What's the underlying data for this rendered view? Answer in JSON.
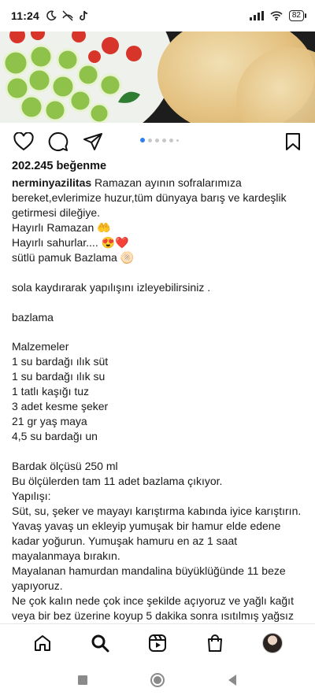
{
  "status_bar": {
    "time": "11:24",
    "icons_left": [
      "moon-icon",
      "no-wifi-call-icon",
      "tiktok-icon"
    ],
    "icons_right": [
      "signal-icon",
      "wifi-icon",
      "battery-icon"
    ],
    "battery": "82"
  },
  "post": {
    "carousel": {
      "count": 6,
      "active": 0
    },
    "likes": "202.245 beğenme",
    "username": "nerminyazilitas",
    "caption_first": "Ramazan ayının sofralarımıza",
    "caption_lines": [
      "bereket,evlerimize huzur,tüm dünyaya barış ve kardeşlik",
      "getirmesi dileğiye.",
      "Hayırlı Ramazan 🤲",
      "Hayırlı sahurlar.... 😍❤️",
      "sütlü pamuk Bazlama 🫓",
      "",
      "sola kaydırarak yapılışını izleyebilirsiniz .",
      "",
      "bazlama",
      "",
      "Malzemeler",
      "1 su bardağı ılık süt",
      "1 su bardağı ılık su",
      "1 tatlı kaşığı tuz",
      "3 adet kesme şeker",
      "21 gr yaş maya",
      "4,5 su bardağı un",
      "",
      "Bardak ölçüsü 250 ml",
      "Bu ölçülerden tam 11 adet bazlama çıkıyor.",
      "Yapılışı:",
      "Süt, su, şeker ve mayayı karıştırma kabında iyice karıştırın.",
      "Yavaş yavaş un ekleyip yumuşak bir hamur elde edene",
      "kadar yoğurun. Yumuşak hamuru en az 1 saat",
      "mayalanmaya bırakın.",
      "Mayalanan hamurdan mandalina büyüklüğünde 11 beze",
      "yapıyoruz.",
      "Ne çok kalın nede çok ince şekilde açıyoruz ve yağlı kağıt",
      "veya bir bez üzerine koyup 5 dakika sonra ısıtılmış yağsız"
    ]
  },
  "icons": {
    "actions": [
      "heart-icon",
      "comment-icon",
      "share-icon",
      "bookmark-icon"
    ],
    "bottom_nav": [
      "home-icon",
      "search-icon",
      "reels-icon",
      "shop-icon",
      "profile-avatar"
    ],
    "system_nav": [
      "recents-icon",
      "home-circle-icon",
      "back-icon"
    ]
  },
  "colors": {
    "accent": "#2f80ed",
    "text": "#1a1a1a"
  }
}
